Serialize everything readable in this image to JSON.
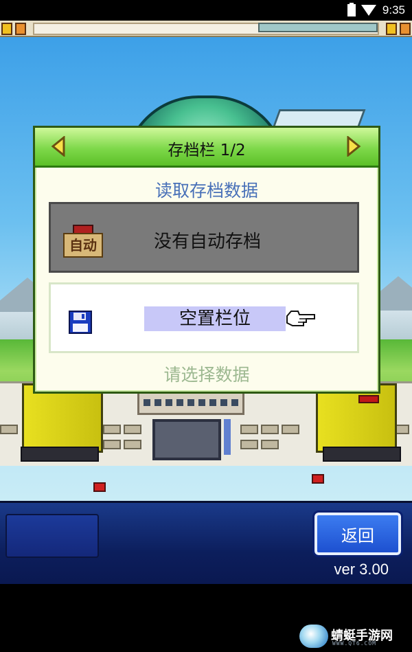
{
  "status_bar": {
    "time": "9:35",
    "wifi_icon": "wifi-icon",
    "battery_icon": "battery-icon"
  },
  "dialog": {
    "title": "存档栏 1/2",
    "prev_icon": "triangle-left-icon",
    "next_icon": "triangle-right-icon",
    "subtitle": "读取存档数据",
    "slots": [
      {
        "icon": "auto-save-icon",
        "icon_text": "自动",
        "label": "没有自动存档",
        "selected": false
      },
      {
        "icon": "floppy-disk-icon",
        "label": "空置栏位",
        "selected": true
      }
    ],
    "cursor_icon": "pointing-hand-icon",
    "hint": "请选择数据"
  },
  "bottom_bar": {
    "back_label": "返回",
    "version": "ver 3.00"
  },
  "watermark": {
    "name": "蜻蜓手游网",
    "url": "WWW.QT6.COM"
  },
  "colors": {
    "header_green": "#7ed84a",
    "subtitle_blue": "#4870b8",
    "back_button": "#2a62e0",
    "bottom_bg": "#0c1e5c"
  }
}
